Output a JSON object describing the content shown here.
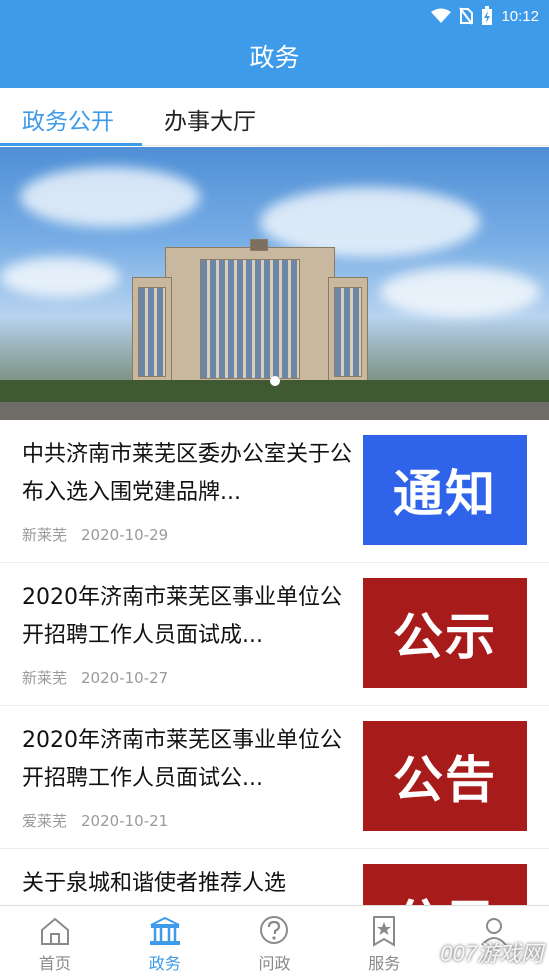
{
  "status_bar": {
    "time": "10:12"
  },
  "header": {
    "title": "政务"
  },
  "tabs": [
    {
      "label": "政务公开",
      "active": true
    },
    {
      "label": "办事大厅",
      "active": false
    }
  ],
  "news": [
    {
      "title": "中共济南市莱芜区委办公室关于公布入选入围党建品牌...",
      "source": "新莱芜",
      "date": "2020-10-29",
      "thumb_text": "通知",
      "thumb_color": "#2f63ea"
    },
    {
      "title": "2020年济南市莱芜区事业单位公开招聘工作人员面试成...",
      "source": "新莱芜",
      "date": "2020-10-27",
      "thumb_text": "公示",
      "thumb_color": "#a81b1b"
    },
    {
      "title": "2020年济南市莱芜区事业单位公开招聘工作人员面试公...",
      "source": "爱莱芜",
      "date": "2020-10-21",
      "thumb_text": "公告",
      "thumb_color": "#a81b1b"
    },
    {
      "title": "关于泉城和谐使者推荐人选",
      "source": "",
      "date": "",
      "thumb_text": "公示",
      "thumb_color": "#a81b1b"
    }
  ],
  "bottom_nav": [
    {
      "label": "首页",
      "icon": "home-icon",
      "active": false
    },
    {
      "label": "政务",
      "icon": "government-building-icon",
      "active": true
    },
    {
      "label": "问政",
      "icon": "question-icon",
      "active": false
    },
    {
      "label": "服务",
      "icon": "star-bookmark-icon",
      "active": false
    },
    {
      "label": "",
      "icon": "user-icon",
      "active": false
    }
  ],
  "watermark": "007游戏网",
  "colors": {
    "primary": "#3d9bea",
    "notice_blue": "#2f63ea",
    "notice_red": "#a81b1b"
  }
}
